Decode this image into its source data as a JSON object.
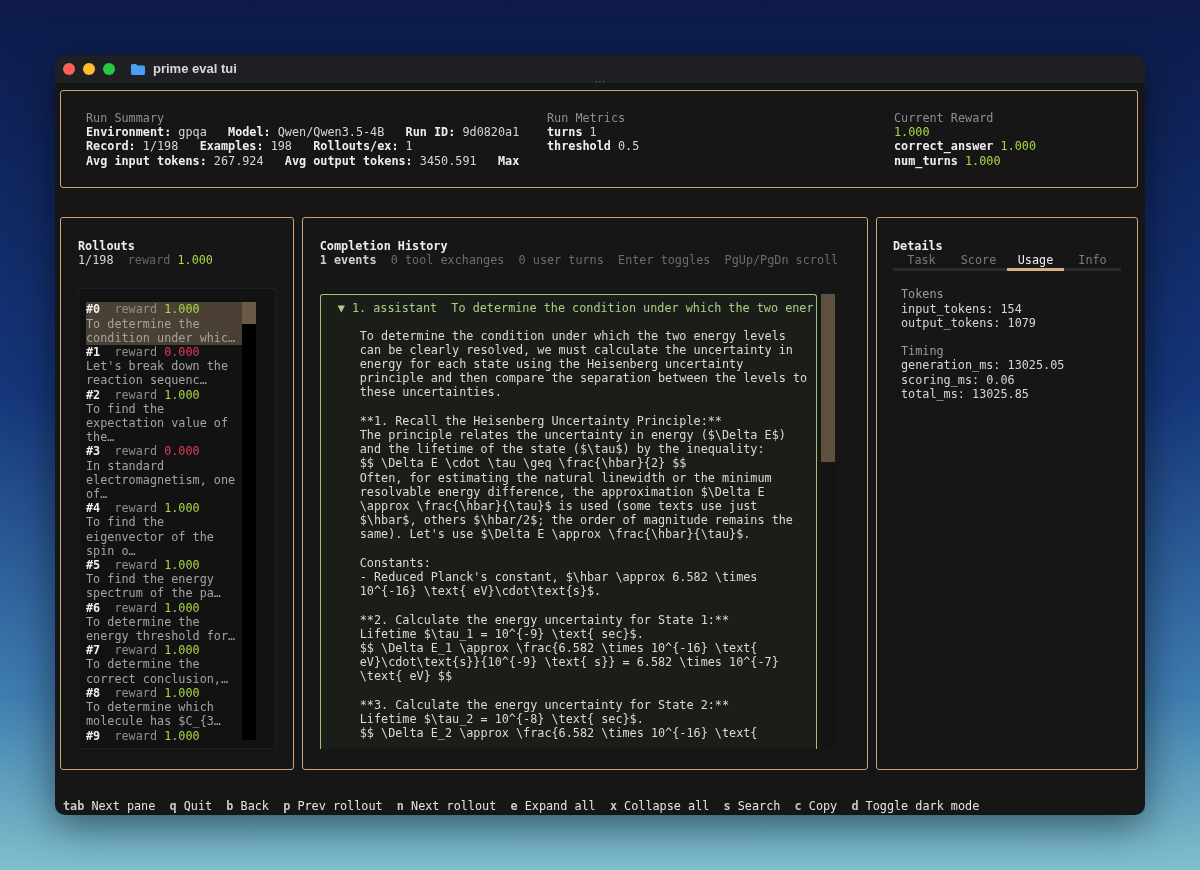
{
  "window": {
    "title": "prime eval tui",
    "handle": "···"
  },
  "summary": {
    "title": "Run Summary",
    "lines": [
      [
        {
          "label": "Environment:",
          "value": "gpqa"
        },
        {
          "label": "Model:",
          "value": "Qwen/Qwen3.5-4B"
        },
        {
          "label": "Run ID:",
          "value": "9d0820a1"
        }
      ],
      [
        {
          "label": "Record:",
          "value": "1/198"
        },
        {
          "label": "Examples:",
          "value": "198"
        },
        {
          "label": "Rollouts/ex:",
          "value": "1"
        }
      ],
      [
        {
          "label": "Avg input tokens:",
          "value": "267.924"
        },
        {
          "label": "Avg output tokens:",
          "value": "3450.591"
        },
        {
          "label": "Max"
        }
      ]
    ]
  },
  "metrics": {
    "title": "Run Metrics",
    "rows": [
      {
        "label": "turns",
        "value": "1"
      },
      {
        "label": "threshold",
        "value": "0.5"
      }
    ]
  },
  "reward": {
    "title": "Current Reward",
    "value": "1.000",
    "rows": [
      {
        "label": "correct_answer",
        "value": "1.000"
      },
      {
        "label": "num_turns",
        "value": "1.000"
      }
    ]
  },
  "rollouts": {
    "title": "Rollouts",
    "count": "1/198",
    "reward_label": "reward",
    "reward": "1.000",
    "items": [
      {
        "number": "#0",
        "reward_label": "reward",
        "reward": "1.000",
        "correct": true,
        "selected": true,
        "text": "To determine the condition under whic…"
      },
      {
        "number": "#1",
        "reward_label": "reward",
        "reward": "0.000",
        "correct": false,
        "selected": false,
        "text": "Let's break down the reaction sequenc…"
      },
      {
        "number": "#2",
        "reward_label": "reward",
        "reward": "1.000",
        "correct": true,
        "selected": false,
        "text": "To find the expectation value of the…"
      },
      {
        "number": "#3",
        "reward_label": "reward",
        "reward": "0.000",
        "correct": false,
        "selected": false,
        "text": "In standard electromagnetism, one of…"
      },
      {
        "number": "#4",
        "reward_label": "reward",
        "reward": "1.000",
        "correct": true,
        "selected": false,
        "text": "To find the eigenvector of the spin o…"
      },
      {
        "number": "#5",
        "reward_label": "reward",
        "reward": "1.000",
        "correct": true,
        "selected": false,
        "text": "To find the energy spectrum of the pa…"
      },
      {
        "number": "#6",
        "reward_label": "reward",
        "reward": "1.000",
        "correct": true,
        "selected": false,
        "text": "To determine the energy threshold for…"
      },
      {
        "number": "#7",
        "reward_label": "reward",
        "reward": "1.000",
        "correct": true,
        "selected": false,
        "text": "To determine the correct conclusion,…"
      },
      {
        "number": "#8",
        "reward_label": "reward",
        "reward": "1.000",
        "correct": true,
        "selected": false,
        "text": "To determine which molecule has $C_{3…"
      },
      {
        "number": "#9",
        "reward_label": "reward",
        "reward": "1.000",
        "correct": true,
        "selected": false
      }
    ]
  },
  "history": {
    "title": "Completion History",
    "stats": [
      "1 events",
      "0 tool exchanges",
      "0 user turns",
      "Enter toggles",
      "PgUp/PgDn scroll"
    ],
    "events": [
      {
        "toggle": "▼",
        "label": "1. assistant",
        "preview": "To determine the condition under which the two ener",
        "expanded": true,
        "paragraphs": [
          "To determine the condition under which the two energy levels can be clearly resolved, we must calculate the uncertainty in energy for each state using the Heisenberg uncertainty principle and then compare the separation between the levels to these uncertainties.",
          "**1. Recall the Heisenberg Uncertainty Principle:**\nThe principle relates the uncertainty in energy ($\\Delta E$) and the lifetime of the state ($\\tau$) by the inequality:\n$$ \\Delta E \\cdot \\tau \\geq \\frac{\\hbar}{2} $$\nOften, for estimating the natural linewidth or the minimum resolvable energy difference, the approximation $\\Delta E \\approx \\frac{\\hbar}{\\tau}$ is used (some texts use just $\\hbar$, others $\\hbar/2$; the order of magnitude remains the same). Let's use $\\Delta E \\approx \\frac{\\hbar}{\\tau}$.",
          "Constants:\n- Reduced Planck's constant, $\\hbar \\approx 6.582 \\times 10^{-16} \\text{ eV}\\cdot\\text{s}$.",
          "**2. Calculate the energy uncertainty for State 1:**\nLifetime $\\tau_1 = 10^{-9} \\text{ sec}$.\n$$ \\Delta E_1 \\approx \\frac{6.582 \\times 10^{-16} \\text{ eV}\\cdot\\text{s}}{10^{-9} \\text{ s}} = 6.582 \\times 10^{-7} \\text{ eV} $$",
          "**3. Calculate the energy uncertainty for State 2:**\nLifetime $\\tau_2 = 10^{-8} \\text{ sec}$.\n$$ \\Delta E_2 \\approx \\frac{6.582 \\times 10^{-16} \\text{"
        ]
      }
    ]
  },
  "details": {
    "title": "Details",
    "tabs": [
      {
        "label": "Task",
        "selected": false
      },
      {
        "label": "Score",
        "selected": false
      },
      {
        "label": "Usage",
        "selected": true
      },
      {
        "label": "Info",
        "selected": false
      }
    ],
    "sections": [
      {
        "title": "Tokens",
        "rows": [
          "input_tokens: 154",
          "output_tokens: 1079"
        ]
      },
      {
        "title": "Timing",
        "rows": [
          "generation_ms: 13025.05",
          "scoring_ms: 0.06",
          "total_ms: 13025.85"
        ]
      }
    ]
  },
  "footer": [
    {
      "key": "tab",
      "label": "Next pane"
    },
    {
      "key": "q",
      "label": "Quit"
    },
    {
      "key": "b",
      "label": "Back"
    },
    {
      "key": "p",
      "label": "Prev rollout"
    },
    {
      "key": "n",
      "label": "Next rollout"
    },
    {
      "key": "e",
      "label": "Expand all"
    },
    {
      "key": "x",
      "label": "Collapse all"
    },
    {
      "key": "s",
      "label": "Search"
    },
    {
      "key": "c",
      "label": "Copy"
    },
    {
      "key": "d",
      "label": "Toggle dark mode"
    }
  ]
}
